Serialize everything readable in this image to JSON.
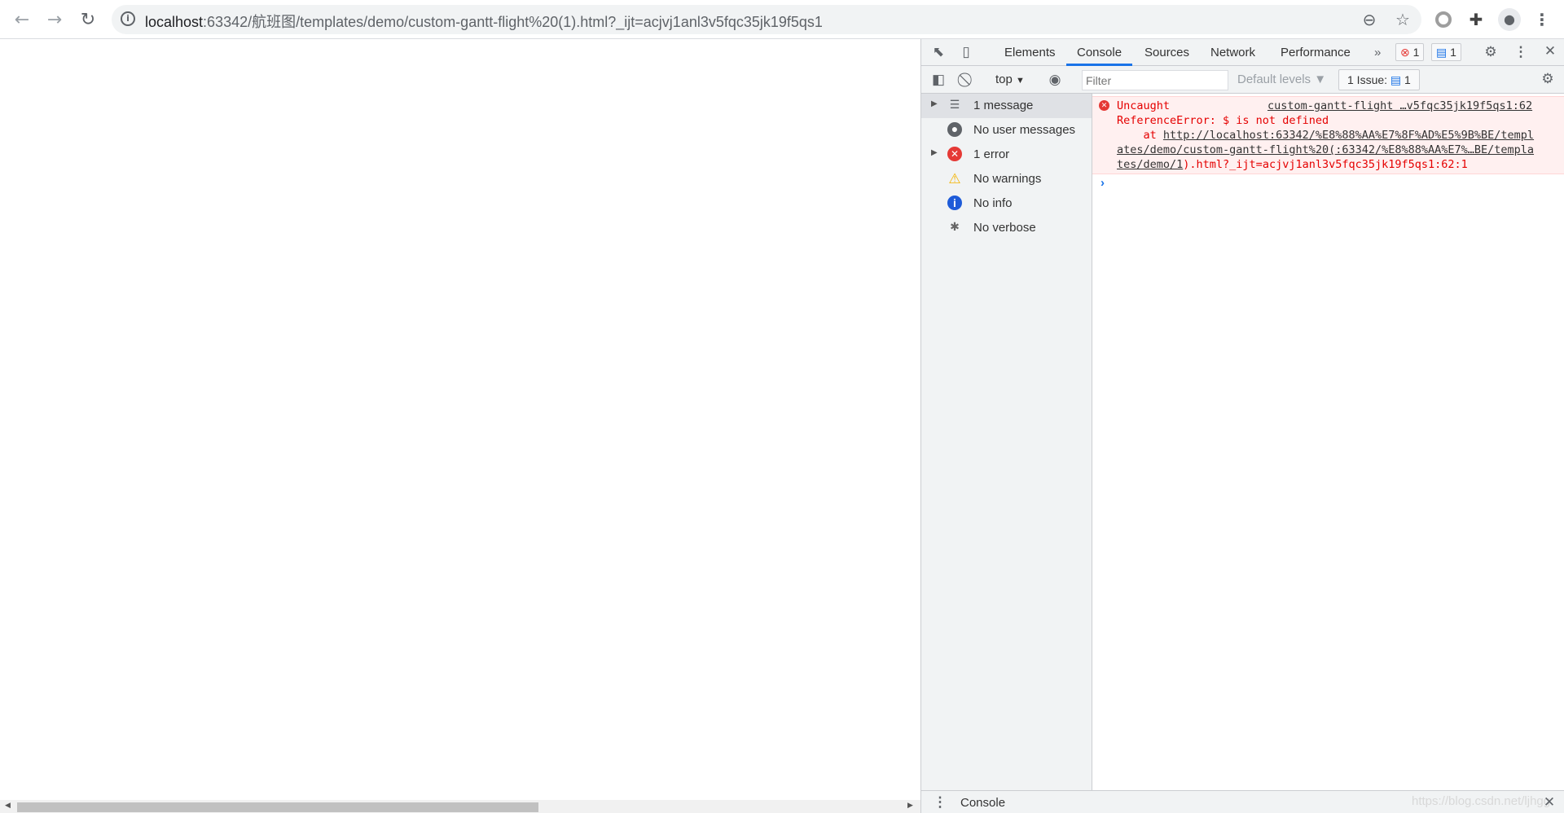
{
  "browser": {
    "url_host": "localhost",
    "url_rest": ":63342/航班图/templates/demo/custom-gantt-flight%20(1).html?_ijt=acjvj1anl3v5fqc35jk19f5qs1"
  },
  "devtools": {
    "tabs": [
      "Elements",
      "Console",
      "Sources",
      "Network",
      "Performance"
    ],
    "active_tab": "Console",
    "error_count": "1",
    "message_count": "1",
    "context": "top",
    "filter_placeholder": "Filter",
    "levels": "Default levels",
    "issues_label": "1 Issue:",
    "issues_count": "1",
    "sidebar": [
      {
        "label": "1 message",
        "icon": "list-icon"
      },
      {
        "label": "No user messages",
        "icon": "user-icon"
      },
      {
        "label": "1 error",
        "icon": "error-icon"
      },
      {
        "label": "No warnings",
        "icon": "warning-icon"
      },
      {
        "label": "No info",
        "icon": "info-icon"
      },
      {
        "label": "No verbose",
        "icon": "bug-icon"
      }
    ],
    "error": {
      "line1": "Uncaught",
      "source": "custom-gantt-flight …v5fqc35jk19f5qs1:62",
      "line2": "ReferenceError: $ is not defined",
      "at": "    at ",
      "link1": "http://localhost:63342/%E8%88%AA%E7%8F%AD%E5%9B%BE/templ",
      "link2": "ates/demo/custom-gantt-flight%20(:63342/%E8%88%AA%E7%…BE/templa",
      "link3": "tes/demo/1",
      "tail": ").html?_ijt=acjvj1anl3v5fqc35jk19f5qs1:62:1"
    },
    "drawer_tab": "Console",
    "watermark": "https://blog.csdn.net/ljhgg"
  },
  "colors": {
    "accent": "#1a73e8",
    "error": "#e50000",
    "error_bg": "#fff0f0"
  }
}
